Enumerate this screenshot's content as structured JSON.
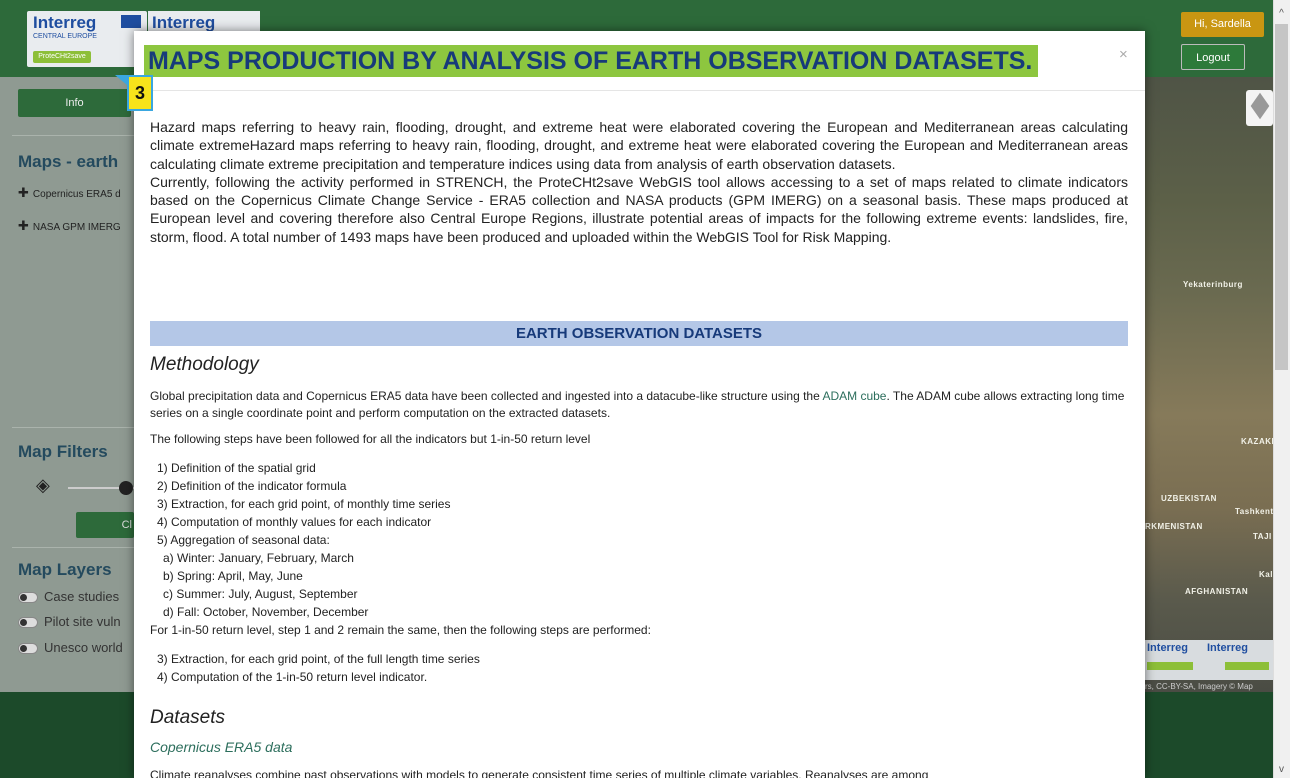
{
  "header": {
    "logo_brand": "Interreg",
    "logo_sub": "CENTRAL EUROPE",
    "logo_pill": "ProteCHt2save",
    "logo2_brand": "Interreg",
    "user_label": "Hi, Sardella",
    "logout_label": "Logout"
  },
  "sidebar": {
    "info_label": "Info",
    "maps_heading": "Maps - earth",
    "items": [
      {
        "label": "Copernicus ERA5 d"
      },
      {
        "label": "NASA GPM IMERG"
      }
    ],
    "filters_heading": "Map Filters",
    "clear_label": "Cl",
    "layers_heading": "Map Layers",
    "layers": [
      {
        "label": "Case studies"
      },
      {
        "label": "Pilot site vuln"
      },
      {
        "label": "Unesco world"
      }
    ]
  },
  "map": {
    "labels": [
      "Yekaterinburg",
      "KAZAKH",
      "UZBEKISTAN",
      "Tashkent",
      "RKMENISTAN",
      "TAJI",
      "AFGHANISTAN",
      "Kal"
    ],
    "logo1": "Interreg",
    "logo2": "Interreg",
    "attribution": "rs, CC-BY-SA, Imagery © Map"
  },
  "modal": {
    "title": "MAPS PRODUCTION BY ANALYSIS OF EARTH OBSERVATION DATASETS.",
    "close": "×",
    "badge": "3",
    "intro_1": "Hazard maps referring to heavy rain, flooding, drought, and extreme heat were elaborated covering the European and Mediterranean areas calculating climate extremeHazard maps referring to heavy rain, flooding, drought, and extreme heat were elaborated covering the European and Mediterranean areas calculating climate extreme precipitation and temperature indices using data from analysis of earth observation datasets.",
    "intro_2": "Currently, following the activity performed in STRENCH, the ProteCHt2save WebGIS tool allows accessing to a set of maps related to climate indicators based on the Copernicus Climate Change Service - ERA5 collection and NASA products (GPM IMERG) on a seasonal basis. These maps produced at European level and covering therefore also Central Europe Regions, illustrate potential areas of impacts for the following extreme events: landslides, fire, storm, flood. A total number of 1493 maps have been produced and uploaded within the WebGIS Tool for Risk Mapping.",
    "section_title": "EARTH OBSERVATION DATASETS",
    "methodology_heading": "Methodology",
    "method_para_pre": "Global precipitation data and Copernicus ERA5 data have been collected and ingested into a datacube-like structure using the",
    "method_link": "ADAM cube",
    "method_para_post": ". The ADAM cube allows extracting long time series on a single coordinate point and perform computation on the extracted datasets.",
    "steps_intro": "The following steps have been followed for all the indicators but 1-in-50 return level",
    "steps": [
      "1) Definition of the spatial grid",
      "2) Definition of the indicator formula",
      "3) Extraction, for each grid point, of monthly time series",
      "4) Computation of monthly values for each indicator",
      "5) Aggregation of seasonal data:"
    ],
    "seasons": [
      "a) Winter: January, February, March",
      "b) Spring: April, May, June",
      "c) Summer: July, August, September",
      "d) Fall: October, November, December"
    ],
    "return_intro": "For 1-in-50 return level, step 1 and 2 remain the same, then the following steps are performed:",
    "return_steps": [
      "3) Extraction, for each grid point, of the full length time series",
      "4) Computation of the 1-in-50 return level indicator."
    ],
    "datasets_heading": "Datasets",
    "era5_link": "Copernicus ERA5 data",
    "era5_para": "Climate reanalyses combine past observations with models to generate consistent time series of multiple climate variables. Reanalyses are among"
  }
}
